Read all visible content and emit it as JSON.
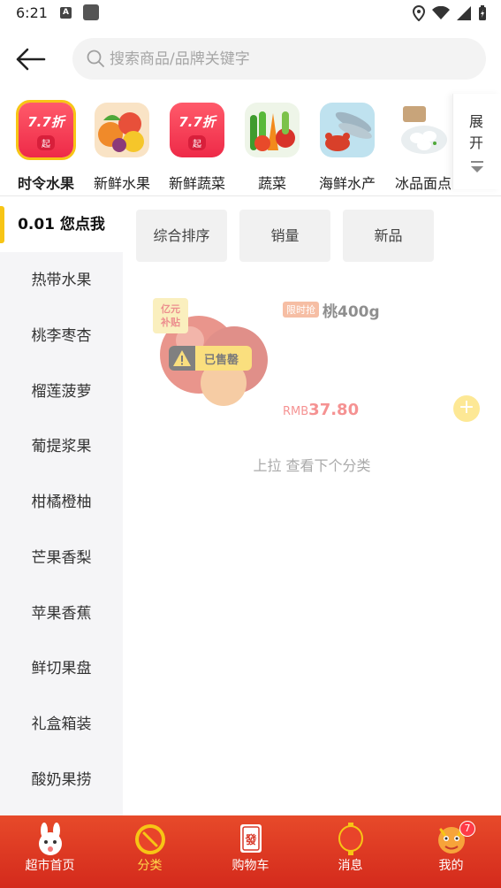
{
  "status_bar": {
    "time": "6:21"
  },
  "search": {
    "placeholder": "搜索商品/品牌关键字"
  },
  "categories": [
    {
      "label": "时令水果",
      "badge_main": "7.7",
      "badge_unit": "折",
      "badge_sub": "起"
    },
    {
      "label": "新鲜水果"
    },
    {
      "label": "新鲜蔬菜",
      "badge_main": "7.7",
      "badge_unit": "折",
      "badge_sub": "起"
    },
    {
      "label": "蔬菜"
    },
    {
      "label": "海鲜水产"
    },
    {
      "label": "冰品面点"
    }
  ],
  "expand_label": "展开",
  "sidebar": {
    "items": [
      "0.01 您点我",
      "热带水果",
      "桃李枣杏",
      "榴莲菠萝",
      "葡提浆果",
      "柑橘橙柚",
      "芒果香梨",
      "苹果香蕉",
      "鲜切果盘",
      "礼盒箱装",
      "酸奶果捞"
    ]
  },
  "sort": [
    "综合排序",
    "销量",
    "新品"
  ],
  "product": {
    "tag": "限时抢",
    "name": "桃400g",
    "image_stamp": "亿元补贴",
    "status": "已售罄",
    "currency": "RMB",
    "price": "37.80"
  },
  "hint": "上拉 查看下个分类",
  "tabs": [
    {
      "label": "超市首页"
    },
    {
      "label": "分类"
    },
    {
      "label": "购物车"
    },
    {
      "label": "消息"
    },
    {
      "label": "我的",
      "badge": "7"
    }
  ],
  "colors": {
    "accent": "#f7c515",
    "tabbar": "#e0391f",
    "price": "#ee3a3a"
  }
}
